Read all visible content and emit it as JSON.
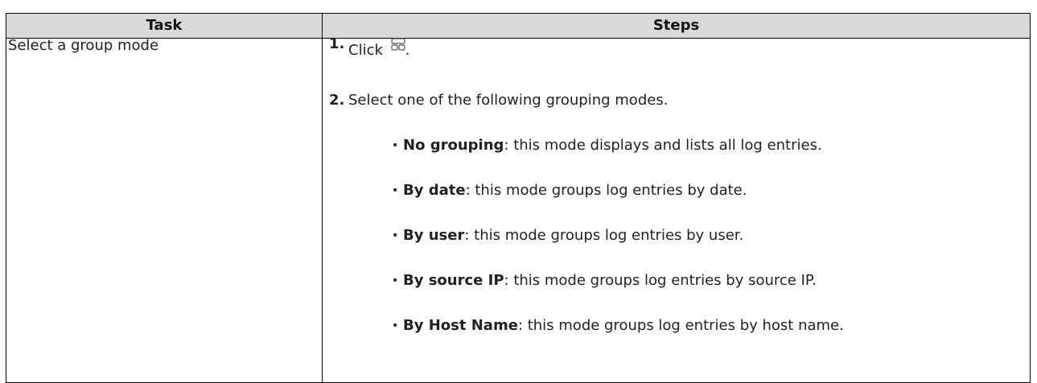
{
  "table": {
    "headers": {
      "task": "Task",
      "steps": "Steps"
    },
    "row": {
      "task": "Select a group mode",
      "step1": {
        "number": "1.",
        "text_before": "Click",
        "icon": "grid-icon",
        "text_after": "."
      },
      "step2": {
        "number": "2.",
        "text": "Select one of the following grouping modes."
      },
      "bullets": [
        {
          "term": "No grouping",
          "desc": ": this mode displays and lists all log entries."
        },
        {
          "term": "By date",
          "desc": ": this mode groups log entries by date."
        },
        {
          "term": "By user",
          "desc": ": this mode groups log entries by user."
        },
        {
          "term": "By source IP",
          "desc": ": this mode groups log entries by source IP."
        },
        {
          "term": "By Host Name",
          "desc": ": this mode groups log entries by host name."
        }
      ]
    }
  },
  "colors": {
    "header_bg": "#d9d9d9",
    "border": "#000000",
    "text": "#222222"
  }
}
